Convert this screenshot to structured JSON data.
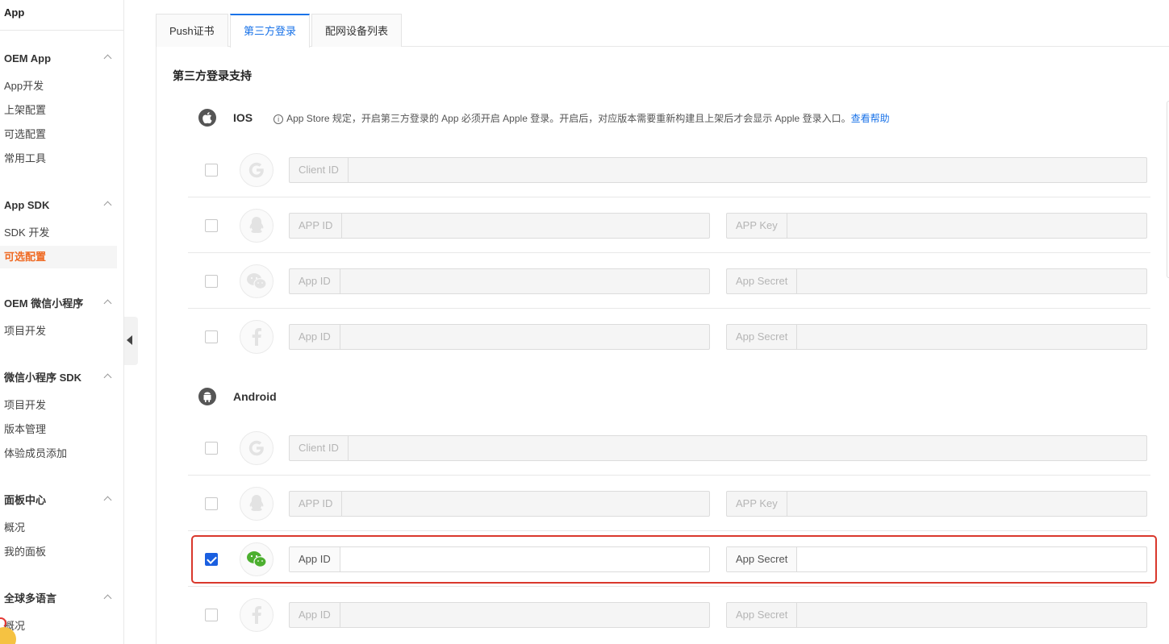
{
  "sidebar": {
    "title": "App",
    "groups": [
      {
        "title": "OEM App",
        "items": [
          {
            "label": "App开发"
          },
          {
            "label": "上架配置"
          },
          {
            "label": "可选配置"
          },
          {
            "label": "常用工具"
          }
        ]
      },
      {
        "title": "App SDK",
        "items": [
          {
            "label": "SDK 开发"
          },
          {
            "label": "可选配置",
            "active": true
          }
        ]
      },
      {
        "title": "OEM 微信小程序",
        "items": [
          {
            "label": "项目开发"
          }
        ]
      },
      {
        "title": "微信小程序 SDK",
        "items": [
          {
            "label": "项目开发"
          },
          {
            "label": "版本管理"
          },
          {
            "label": "体验成员添加"
          }
        ]
      },
      {
        "title": "面板中心",
        "items": [
          {
            "label": "概况"
          },
          {
            "label": "我的面板"
          }
        ]
      },
      {
        "title": "全球多语言",
        "items": [
          {
            "label": "概况"
          }
        ]
      }
    ]
  },
  "tabs": [
    {
      "label": "Push证书",
      "active": false
    },
    {
      "label": "第三方登录",
      "active": true
    },
    {
      "label": "配网设备列表",
      "active": false
    }
  ],
  "section_title": "第三方登录支持",
  "ios": {
    "name": "IOS",
    "note": "App Store 规定，开启第三方登录的 App 必须开启 Apple 登录。开启后，对应版本需要重新构建且上架后才会显示 Apple 登录入口。",
    "help_link": "查看帮助"
  },
  "android": {
    "name": "Android"
  },
  "providers": {
    "google": {
      "field1_label": "Client ID",
      "field1_value": ""
    },
    "qq": {
      "field1_label": "APP ID",
      "field1_value": "",
      "field2_label": "APP Key",
      "field2_value": ""
    },
    "wechat": {
      "field1_label": "App ID",
      "field1_value": "",
      "field2_label": "App Secret",
      "field2_value": ""
    },
    "facebook": {
      "field1_label": "App ID",
      "field1_value": "",
      "field2_label": "App Secret",
      "field2_value": ""
    }
  },
  "state": {
    "ios_wechat_checked": false,
    "android_wechat_checked": true
  },
  "colors": {
    "accent": "#1a73e8",
    "active_nav": "#ef6a23",
    "highlight": "#d9382c",
    "wechat_green": "#4caf2f"
  }
}
